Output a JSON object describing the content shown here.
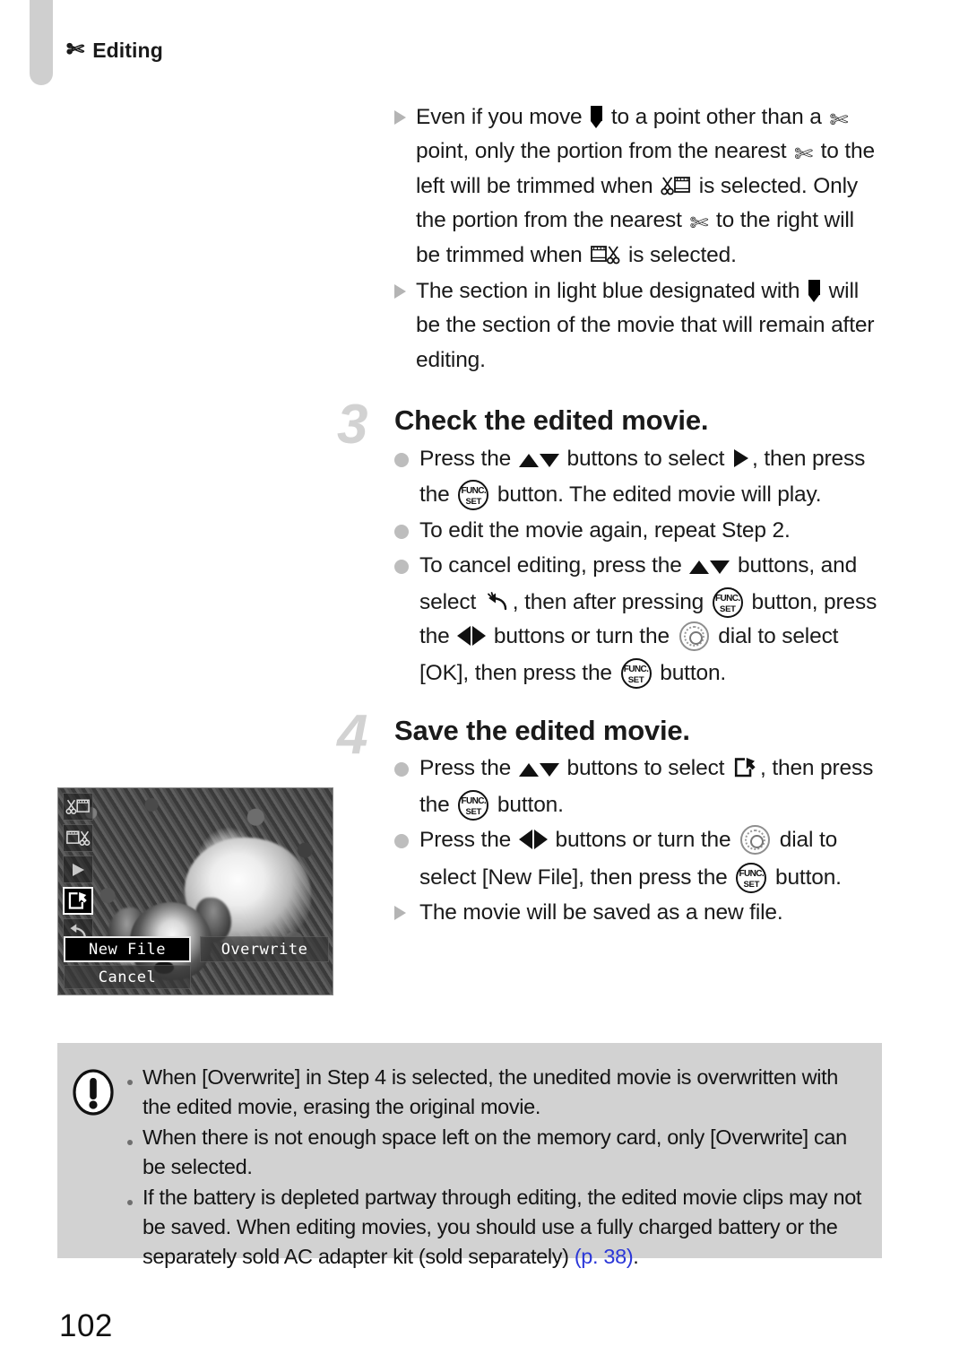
{
  "running_head": {
    "icon": "scissors-icon",
    "label": "Editing"
  },
  "notes_top": [
    {
      "icon_bullet": "triangle-bullet-icon",
      "segments": [
        {
          "t": "text",
          "v": "Even if you move "
        },
        {
          "t": "icon",
          "v": "position-marker-icon"
        },
        {
          "t": "text",
          "v": " to a point other than a "
        },
        {
          "t": "icon",
          "v": "scissors-icon"
        },
        {
          "t": "text",
          "v": " point, only the portion from the nearest "
        },
        {
          "t": "icon",
          "v": "scissors-icon"
        },
        {
          "t": "text",
          "v": " to the left will be trimmed when "
        },
        {
          "t": "icon",
          "v": "trim-start-icon"
        },
        {
          "t": "text",
          "v": " is selected. Only the portion from the nearest "
        },
        {
          "t": "icon",
          "v": "scissors-icon"
        },
        {
          "t": "text",
          "v": " to the right will be trimmed when "
        },
        {
          "t": "icon",
          "v": "trim-end-icon"
        },
        {
          "t": "text",
          "v": " is selected."
        }
      ]
    },
    {
      "icon_bullet": "triangle-bullet-icon",
      "segments": [
        {
          "t": "text",
          "v": "The section in light blue designated with "
        },
        {
          "t": "icon",
          "v": "position-marker-icon"
        },
        {
          "t": "text",
          "v": " will be the section of the movie that will remain after editing."
        }
      ]
    }
  ],
  "steps": [
    {
      "number": "3",
      "title": "Check the edited movie.",
      "items": [
        {
          "bullet": "round-bullet-icon",
          "segments": [
            {
              "t": "text",
              "v": "Press the "
            },
            {
              "t": "icon",
              "v": "up-down-buttons-icon"
            },
            {
              "t": "text",
              "v": " buttons to select "
            },
            {
              "t": "icon",
              "v": "play-icon"
            },
            {
              "t": "text",
              "v": ", then press the "
            },
            {
              "t": "icon",
              "v": "func-set-button-icon"
            },
            {
              "t": "text",
              "v": " button. The edited movie will play."
            }
          ]
        },
        {
          "bullet": "round-bullet-icon",
          "segments": [
            {
              "t": "text",
              "v": "To edit the movie again, repeat Step 2."
            }
          ]
        },
        {
          "bullet": "round-bullet-icon",
          "segments": [
            {
              "t": "text",
              "v": "To cancel editing, press the "
            },
            {
              "t": "icon",
              "v": "up-down-buttons-icon"
            },
            {
              "t": "text",
              "v": " buttons, and select "
            },
            {
              "t": "icon",
              "v": "undo-icon"
            },
            {
              "t": "text",
              "v": ", then after pressing "
            },
            {
              "t": "icon",
              "v": "func-set-button-icon"
            },
            {
              "t": "text",
              "v": " button, press the "
            },
            {
              "t": "icon",
              "v": "left-right-buttons-icon"
            },
            {
              "t": "text",
              "v": " buttons or turn the "
            },
            {
              "t": "icon",
              "v": "control-dial-icon"
            },
            {
              "t": "text",
              "v": " dial to select [OK], then press the "
            },
            {
              "t": "icon",
              "v": "func-set-button-icon"
            },
            {
              "t": "text",
              "v": " button."
            }
          ]
        }
      ]
    },
    {
      "number": "4",
      "title": "Save the edited movie.",
      "items": [
        {
          "bullet": "round-bullet-icon",
          "segments": [
            {
              "t": "text",
              "v": "Press the "
            },
            {
              "t": "icon",
              "v": "up-down-buttons-icon"
            },
            {
              "t": "text",
              "v": " buttons to select "
            },
            {
              "t": "icon",
              "v": "save-new-file-icon"
            },
            {
              "t": "text",
              "v": ", then press the "
            },
            {
              "t": "icon",
              "v": "func-set-button-icon"
            },
            {
              "t": "text",
              "v": " button."
            }
          ]
        },
        {
          "bullet": "round-bullet-icon",
          "segments": [
            {
              "t": "text",
              "v": "Press the "
            },
            {
              "t": "icon",
              "v": "left-right-buttons-icon"
            },
            {
              "t": "text",
              "v": " buttons or turn the "
            },
            {
              "t": "icon",
              "v": "control-dial-icon"
            },
            {
              "t": "text",
              "v": " dial to select [New File], then press the "
            },
            {
              "t": "icon",
              "v": "func-set-button-icon"
            },
            {
              "t": "text",
              "v": " button."
            }
          ]
        },
        {
          "bullet": "triangle-bullet-icon",
          "segments": [
            {
              "t": "text",
              "v": "The movie will be saved as a new file."
            }
          ]
        }
      ]
    }
  ],
  "lcd": {
    "side_buttons": [
      {
        "name": "trim-start-icon",
        "selected": false
      },
      {
        "name": "trim-end-icon",
        "selected": false
      },
      {
        "name": "play-icon",
        "selected": false
      },
      {
        "name": "save-new-file-icon",
        "selected": true
      },
      {
        "name": "undo-icon",
        "selected": false
      }
    ],
    "options": {
      "new_file": "New File",
      "overwrite": "Overwrite",
      "cancel": "Cancel",
      "selected": "New File"
    }
  },
  "caution": {
    "icon": "caution-exclamation-icon",
    "items": [
      {
        "text": "When [Overwrite] in Step 4 is selected, the unedited movie is overwritten with the edited movie, erasing the original movie.",
        "ref": "",
        "tail": ""
      },
      {
        "text": "When there is not enough space left on the memory card, only [Overwrite] can be selected.",
        "ref": "",
        "tail": ""
      },
      {
        "text": "If the battery is depleted partway through editing, the edited movie clips may not be saved. When editing movies, you should use a fully charged battery or the separately sold AC adapter kit (sold separately) ",
        "ref": "(p. 38)",
        "tail": "."
      }
    ]
  },
  "page_number": "102",
  "colors": {
    "bullet_grey": "#bdbdbd",
    "triangle_grey": "#b4b4b4",
    "step_number_grey": "#d2d2d2",
    "caution_bg": "#d2d2d2",
    "page_ref_blue": "#2b37d8",
    "tab_grey": "#cfcfcf"
  }
}
